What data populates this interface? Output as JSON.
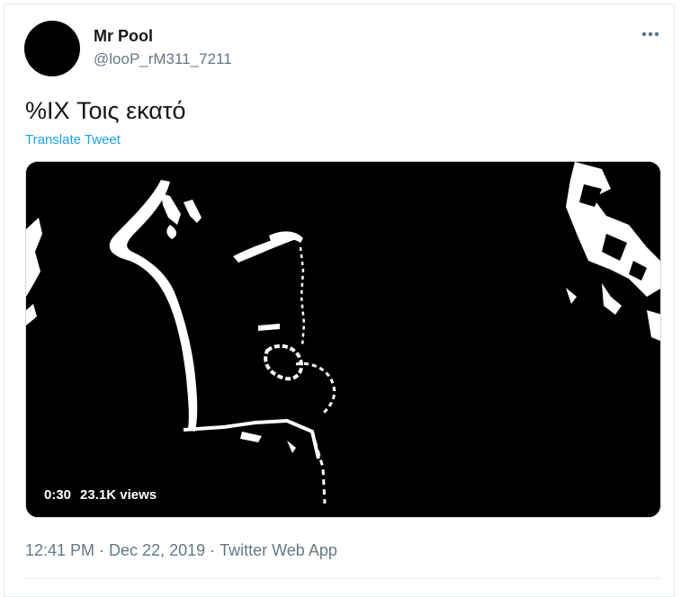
{
  "author": {
    "display_name": "Mr Pool",
    "handle": "@looP_rM311_7211",
    "avatar_color": "#000000"
  },
  "tweet": {
    "text": "%IX Τοις εκατό",
    "translate_label": "Translate Tweet"
  },
  "video": {
    "duration": "0:30",
    "views": "23.1K views"
  },
  "meta": {
    "time": "12:41 PM",
    "date": "Dec 22, 2019",
    "source": "Twitter Web App",
    "separator": "·"
  },
  "icons": {
    "more": "more-horizontal-icon"
  },
  "colors": {
    "link": "#1da1f2",
    "secondary_text": "#657786",
    "primary_text": "#14171a",
    "media_background": "#000000"
  }
}
